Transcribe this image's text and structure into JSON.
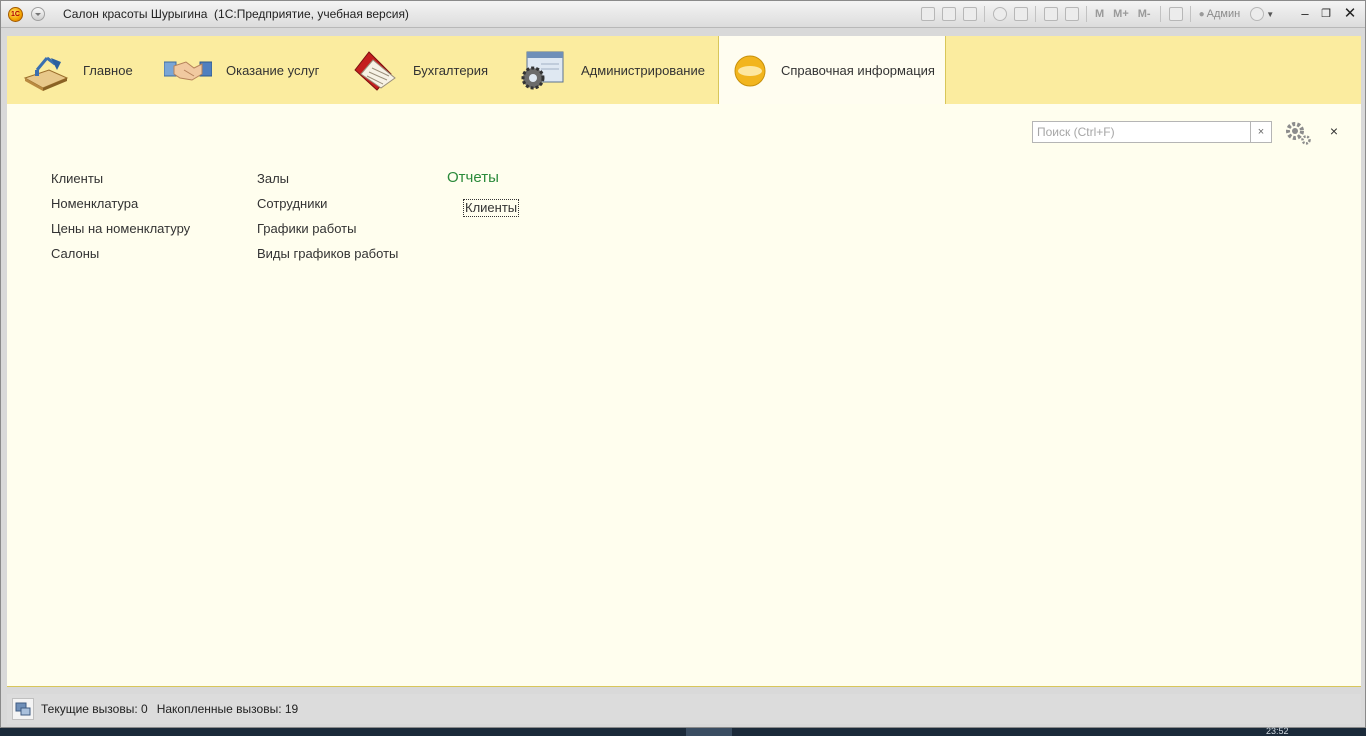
{
  "window": {
    "title": "Салон красоты Шурыгина  (1С:Предприятие, учебная версия)",
    "logo_text": "1С",
    "toolbar_m": [
      "M",
      "M+",
      "M-"
    ],
    "user": "Админ"
  },
  "sections": [
    {
      "label": "Главное",
      "icon": "desk-lamp-icon"
    },
    {
      "label": "Оказание услуг",
      "icon": "handshake-icon"
    },
    {
      "label": "Бухгалтерия",
      "icon": "ledger-book-icon"
    },
    {
      "label": "Администрирование",
      "icon": "admin-gear-icon"
    },
    {
      "label": "Справочная информация",
      "icon": "reference-circle-icon",
      "active": true
    }
  ],
  "search": {
    "placeholder": "Поиск (Ctrl+F)",
    "clear_label": "×"
  },
  "close_label": "×",
  "columns": [
    [
      "Клиенты",
      "Номенклатура",
      "Цены на номенклатуру",
      "Салоны"
    ],
    [
      "Залы",
      "Сотрудники",
      "Графики работы",
      "Виды графиков работы"
    ]
  ],
  "reports": {
    "title": "Отчеты",
    "items": [
      "Клиенты"
    ]
  },
  "status": {
    "current_calls": "Текущие вызовы: 0",
    "accumulated_calls": "Накопленные вызовы: 19"
  },
  "taskbar": {
    "clock": "23:52"
  },
  "colors": {
    "sections_bg": "#fbec9f",
    "content_bg": "#fffeee",
    "reports_title": "#2a8a3a"
  }
}
